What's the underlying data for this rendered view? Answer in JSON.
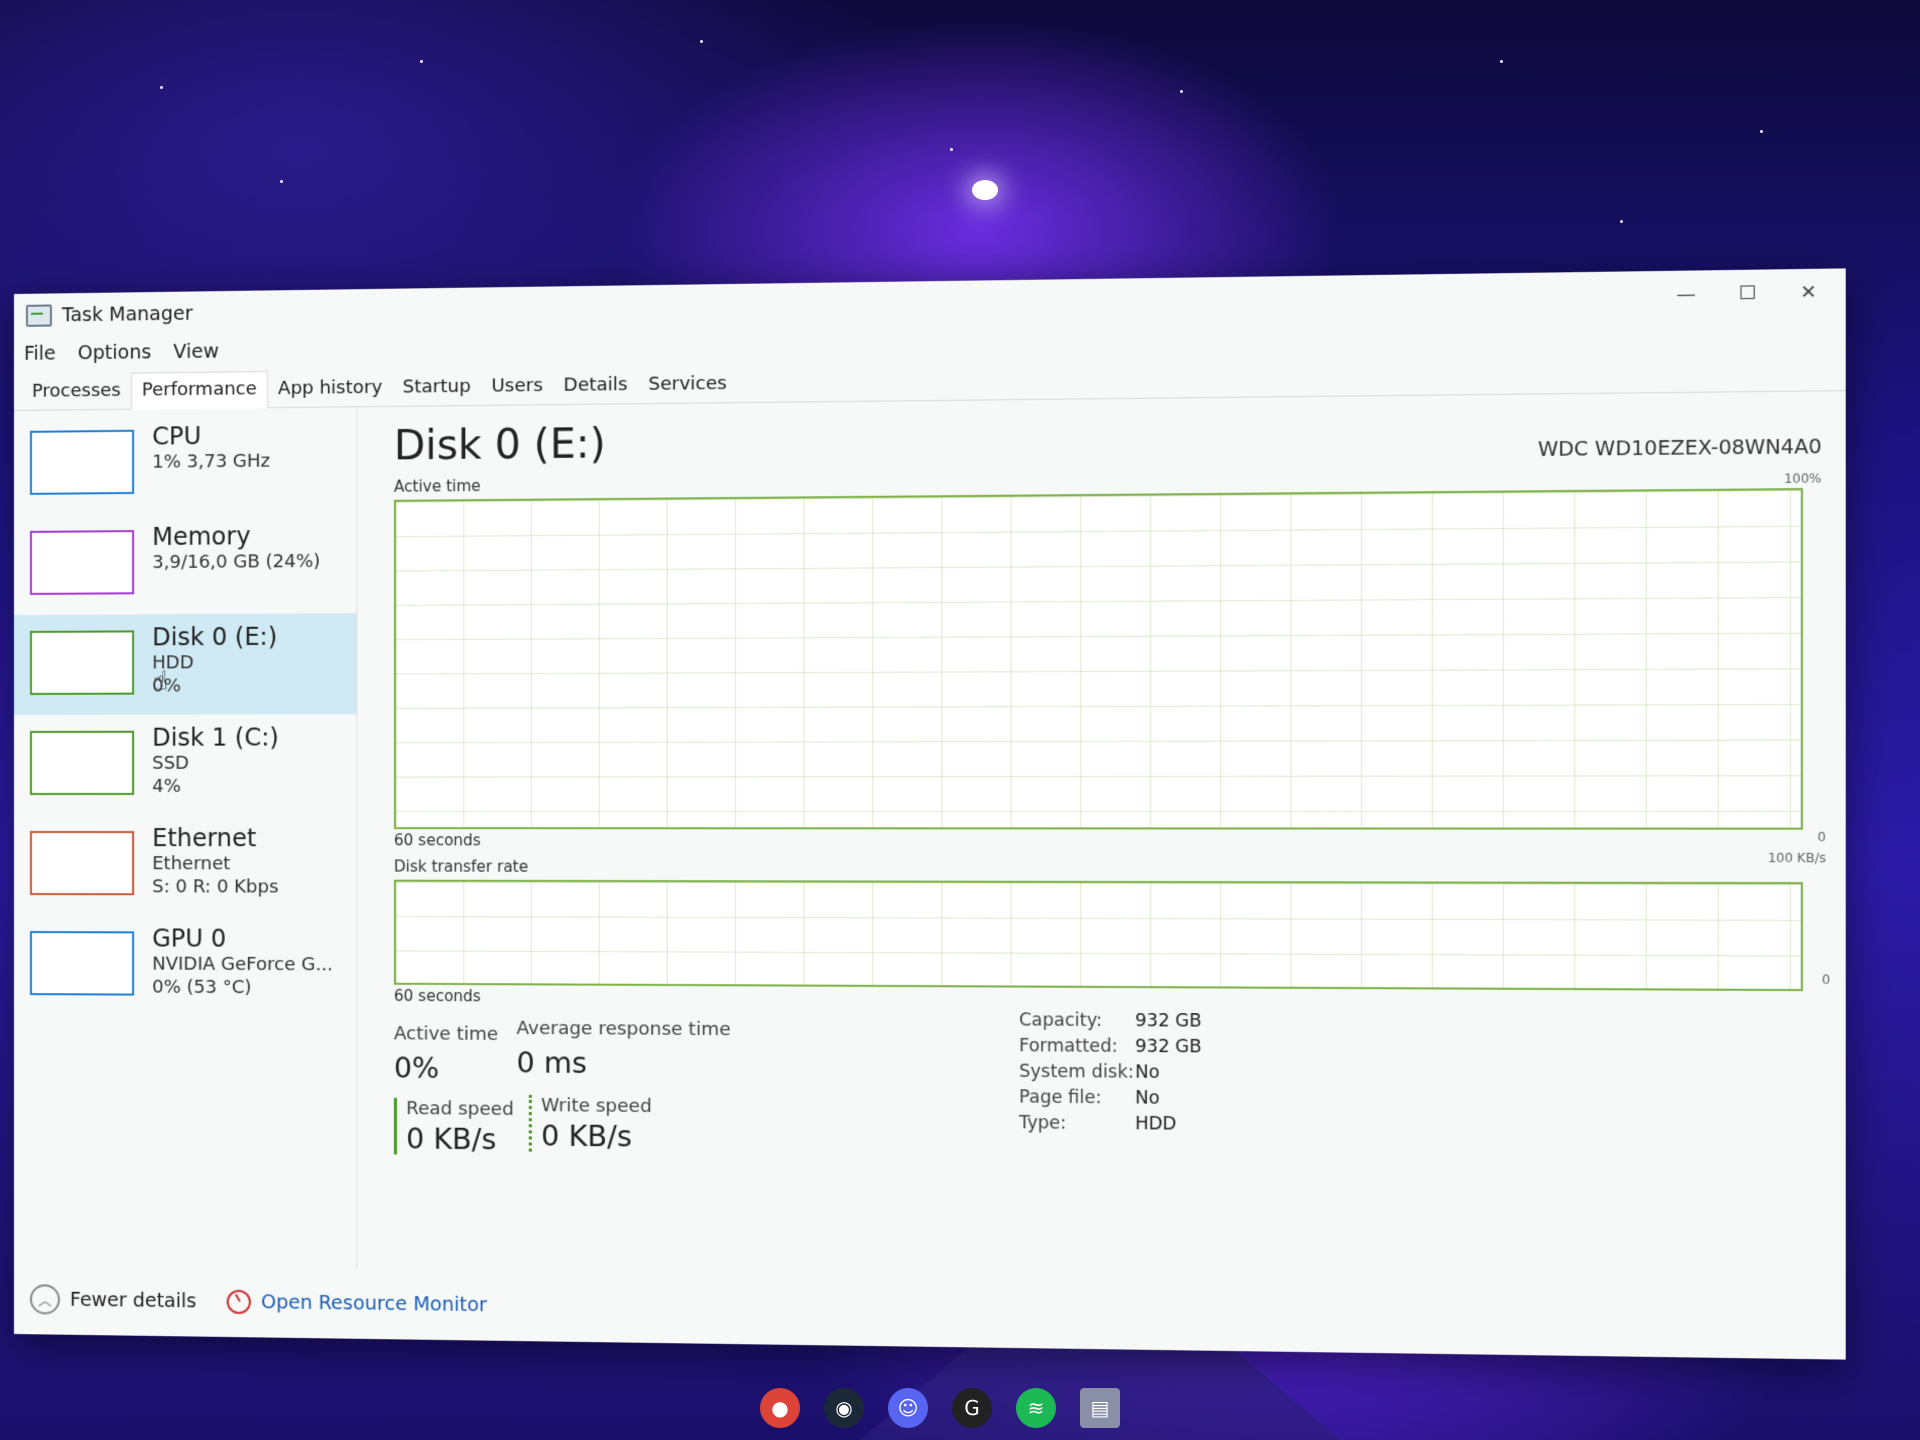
{
  "window": {
    "title": "Task Manager",
    "minimize": "—",
    "maximize": "☐",
    "close": "✕"
  },
  "menu": [
    "File",
    "Options",
    "View"
  ],
  "tabs": [
    "Processes",
    "Performance",
    "App history",
    "Startup",
    "Users",
    "Details",
    "Services"
  ],
  "active_tab": "Performance",
  "sidebar": [
    {
      "title": "CPU",
      "line1": "1% 3,73 GHz",
      "line2": "",
      "color": "#1e7fd6"
    },
    {
      "title": "Memory",
      "line1": "3,9/16,0 GB (24%)",
      "line2": "",
      "color": "#a63ad1"
    },
    {
      "title": "Disk 0 (E:)",
      "line1": "HDD",
      "line2": "0%",
      "color": "#4a9a2a"
    },
    {
      "title": "Disk 1 (C:)",
      "line1": "SSD",
      "line2": "4%",
      "color": "#4a9a2a"
    },
    {
      "title": "Ethernet",
      "line1": "Ethernet",
      "line2": "S: 0 R: 0 Kbps",
      "color": "#c8583a"
    },
    {
      "title": "GPU 0",
      "line1": "NVIDIA GeForce G...",
      "line2": "0% (53 °C)",
      "color": "#1e7fd6"
    }
  ],
  "main": {
    "title": "Disk 0 (E:)",
    "model": "WDC WD10EZEX-08WN4A0",
    "active_time_label": "Active time",
    "active_max": "100%",
    "active_min": "0",
    "seconds_label_1": "60 seconds",
    "transfer_label": "Disk transfer rate",
    "transfer_max": "100 KB/s",
    "transfer_min": "0",
    "seconds_label_2": "60 seconds"
  },
  "stats": {
    "active_time_label": "Active time",
    "active_time_value": "0%",
    "avg_response_label": "Average response time",
    "avg_response_value": "0 ms",
    "read_label": "Read speed",
    "read_value": "0 KB/s",
    "write_label": "Write speed",
    "write_value": "0 KB/s"
  },
  "properties": [
    {
      "key": "Capacity:",
      "value": "932 GB"
    },
    {
      "key": "Formatted:",
      "value": "932 GB"
    },
    {
      "key": "System disk:",
      "value": "No"
    },
    {
      "key": "Page file:",
      "value": "No"
    },
    {
      "key": "Type:",
      "value": "HDD"
    }
  ],
  "footer": {
    "fewer_details": "Fewer details",
    "open_resource_monitor": "Open Resource Monitor"
  },
  "taskbar_icons": [
    "chrome-icon",
    "steam-icon",
    "discord-icon",
    "logitech-icon",
    "spotify-icon",
    "task-manager-icon"
  ]
}
